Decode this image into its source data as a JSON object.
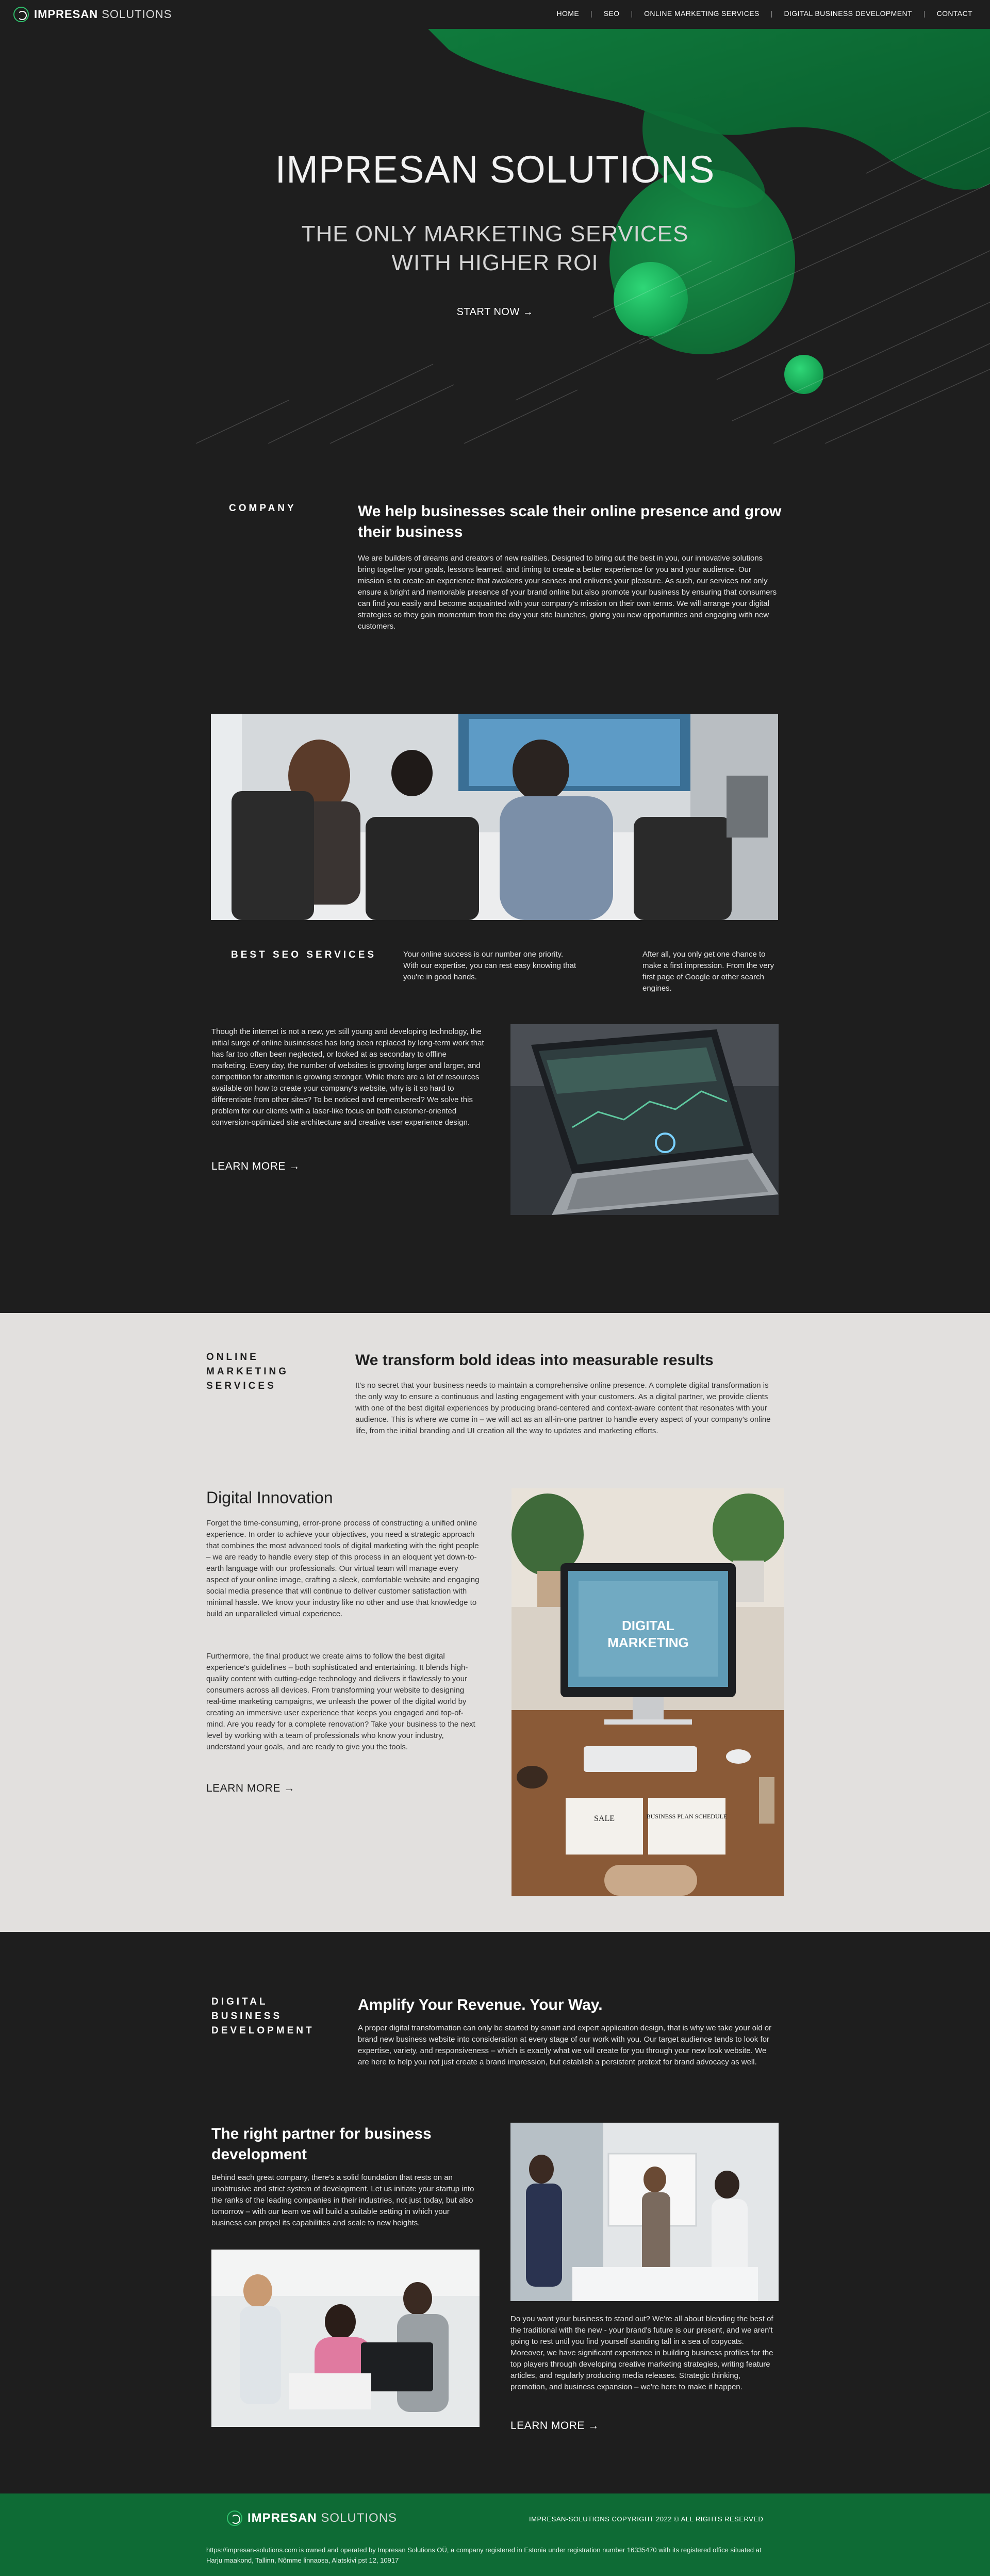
{
  "nav": {
    "logo_bold": "IMPRESAN",
    "logo_light": " SOLUTIONS",
    "items": [
      "HOME",
      "SEO",
      "ONLINE MARKETING SERVICES",
      "DIGITAL BUSINESS DEVELOPMENT",
      "CONTACT"
    ]
  },
  "hero": {
    "title": "IMPRESAN SOLUTIONS",
    "subtitle": "THE ONLY MARKETING SERVICES WITH HIGHER ROI",
    "cta": "START NOW →"
  },
  "company": {
    "label": "COMPANY",
    "title": "We help businesses scale their online presence and grow their business",
    "body": "We are builders of dreams and creators of new realities. Designed to bring out the best in you, our innovative solutions bring together your goals, lessons learned, and timing to create a better experience for you and your audience. Our mission is to create an experience that awakens your senses and enlivens your pleasure. As such, our services not only ensure a bright and memorable presence of your brand online but also promote your business by ensuring that consumers can find you easily and become acquainted with your company's mission on their own terms. We will arrange your digital strategies so they gain momentum from the day your site launches, giving you new opportunities and engaging with new customers."
  },
  "seo": {
    "label": "BEST SEO SERVICES",
    "col1": "Your online success is our number one priority. With our expertise, you can rest easy knowing that you're in good hands.",
    "col2": "After all, you only get one chance to make a first impression. From the very first page of Google or other search engines.",
    "body": "Though the internet is not a new, yet still young and developing technology, the initial surge of online businesses has long been replaced by long-term work that has far too often been neglected, or looked at as secondary to offline marketing. Every day, the number of websites is growing larger and larger, and competition for attention is growing stronger. While there are a lot of resources available on how to create your company's website, why is it so hard to differentiate from other sites? To be noticed and remembered? We solve this problem for our clients with a laser-like focus on both customer-oriented conversion-optimized site architecture and creative user experience design.",
    "learn": "LEARN MORE →"
  },
  "online_marketing": {
    "label": "ONLINE MARKETING SERVICES",
    "title": "We transform bold ideas into measurable results",
    "body": "It's no secret that your business needs to maintain a comprehensive online presence. A complete digital transformation is the only way to ensure a continuous and lasting engagement with your customers. As a digital partner, we provide clients with one of the best digital experiences by producing brand-centered and context-aware content that resonates with your audience. This is where we come in – we will act as an all-in-one partner to handle every aspect of your company's online life, from the initial branding and UI creation all the way to updates and marketing efforts.",
    "di_title": "Digital Innovation",
    "di_body1": "Forget the time-consuming, error-prone process of constructing a unified online experience. In order to achieve your objectives, you need a strategic approach that combines the most advanced tools of digital marketing with the right people – we are ready to handle every step of this process in an eloquent yet down-to-earth language with our professionals. Our virtual team will manage every aspect of your online image, crafting a sleek, comfortable website and engaging social media presence that will continue to deliver customer satisfaction with minimal hassle. We know your industry like no other and use that knowledge to build an unparalleled virtual experience.",
    "di_body2": "Furthermore, the final product we create aims to follow the best digital experience's guidelines – both sophisticated and entertaining. It blends high-quality content with cutting-edge technology and delivers it flawlessly to your consumers across all devices. From transforming your website to designing real-time marketing campaigns, we unleash the power of the digital world by creating an immersive user experience that keeps you engaged and top-of-mind. Are you ready for a complete renovation? Take your business to the next level by working with a team of professionals who know your industry, understand your goals, and are ready to give you the tools.",
    "learn": "LEARN MORE →",
    "screen_text_1": "DIGITAL",
    "screen_text_2": "MARKETING",
    "notebook_1": "SALE",
    "notebook_2": "BUSINESS PLAN SCHEDULE"
  },
  "digital_business": {
    "label": "DIGITAL BUSINESS DEVELOPMENT",
    "title": "Amplify Your Revenue. Your Way.",
    "body": "A proper digital transformation can only be started by smart and expert application design, that is why we take your old or brand new business website into consideration at every stage of our work with you. Our target audience tends to look for expertise, variety, and responsiveness – which is exactly what we will create for you through your new look website. We are here to help you not just create a brand impression, but establish a persistent pretext for brand advocacy as well.",
    "rp_title": "The right partner for business development",
    "rp_body": "Behind each great company, there's a solid foundation that rests on an unobtrusive and strict system of development. Let us initiate your startup into the ranks of the leading companies in their industries, not just today, but also tomorrow – with our team we will build a suitable setting in which your business can propel its capabilities and scale to new heights.",
    "body2": "Do you want your business to stand out? We're all about blending the best of the traditional with the new - your brand's future is our present, and we aren't going to rest until you find yourself standing tall in a sea of copycats. Moreover, we have significant experience in building business profiles for the top players through developing creative marketing strategies, writing feature articles, and regularly producing media releases. Strategic thinking, promotion, and business expansion – we're here to make it happen.",
    "learn": "LEARN MORE →"
  },
  "footer": {
    "logo_bold": "IMPRESAN",
    "logo_light": " SOLUTIONS",
    "copyright": "IMPRESAN-SOLUTIONS COPYRIGHT 2022 © ALL RIGHTS RESERVED",
    "legal": "https://impresan-solutions.com is owned and operated by Impresan Solutions OÜ, a company registered in Estonia under registration number 16335470 with its registered office situated at Harju maakond, Tallinn, Nõmme linnaosa, Alatskivi pst 12, 10917"
  },
  "colors": {
    "background_dark": "#1e1e1e",
    "background_light": "#e2e0de",
    "accent_green": "#0e6b35",
    "bright_green": "#1fbf5c"
  }
}
